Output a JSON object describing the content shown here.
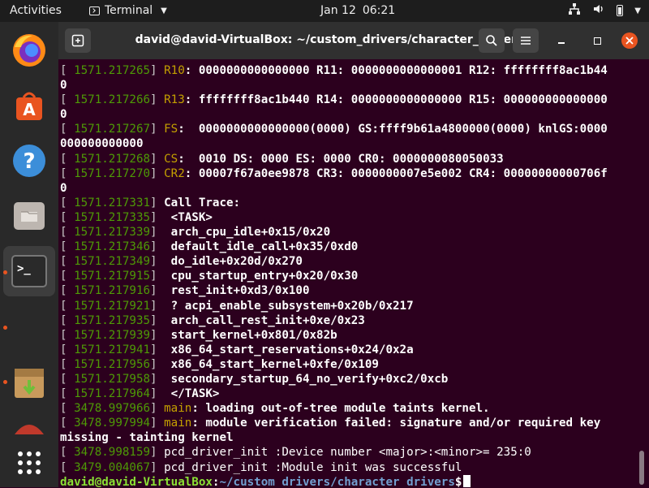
{
  "topbar": {
    "activities": "Activities",
    "app_name": "Terminal",
    "date": "Jan 12",
    "time": "06:21"
  },
  "dock": {
    "items": [
      "firefox-icon",
      "ubuntu-software-icon",
      "help-icon",
      "files-icon",
      "terminal-icon",
      "archive-installer-icon",
      "partial-app-icon",
      "show-apps-icon"
    ]
  },
  "window": {
    "title": "david@david-VirtualBox: ~/custom_drivers/character_drivers"
  },
  "colors": {
    "terminal_bg": "#2c001e",
    "timestamp": "#4e9a06",
    "register": "#c4a000",
    "prompt_user": "#8ae234",
    "prompt_path": "#729fcf",
    "close_button": "#e95420"
  },
  "terminal": {
    "lines": [
      {
        "ts": " 1571.217265",
        "label": "R10",
        "rest": ": 0000000000000000 R11: 0000000000000001 R12: ffffffff8ac1b44"
      },
      {
        "wrap": "0"
      },
      {
        "ts": " 1571.217266",
        "label": "R13",
        "rest": ": ffffffff8ac1b440 R14: 0000000000000000 R15: 000000000000000"
      },
      {
        "wrap": "0"
      },
      {
        "ts": " 1571.217267",
        "label": "FS",
        "rest": ":  0000000000000000(0000) GS:ffff9b61a4800000(0000) knlGS:0000"
      },
      {
        "wrap": "000000000000"
      },
      {
        "ts": " 1571.217268",
        "label": "CS",
        "rest": ":  0010 DS: 0000 ES: 0000 CR0: 0000000080050033"
      },
      {
        "ts": " 1571.217270",
        "label": "CR2",
        "rest": ": 00007f67a0ee9878 CR3: 0000000007e5e002 CR4: 00000000000706f"
      },
      {
        "wrap": "0"
      },
      {
        "ts": " 1571.217331",
        "text": "Call Trace:"
      },
      {
        "ts": " 1571.217335",
        "text": " <TASK>"
      },
      {
        "ts": " 1571.217339",
        "text": " arch_cpu_idle+0x15/0x20"
      },
      {
        "ts": " 1571.217346",
        "text": " default_idle_call+0x35/0xd0"
      },
      {
        "ts": " 1571.217349",
        "text": " do_idle+0x20d/0x270"
      },
      {
        "ts": " 1571.217915",
        "text": " cpu_startup_entry+0x20/0x30"
      },
      {
        "ts": " 1571.217916",
        "text": " rest_init+0xd3/0x100"
      },
      {
        "ts": " 1571.217921",
        "text": " ? acpi_enable_subsystem+0x20b/0x217"
      },
      {
        "ts": " 1571.217935",
        "text": " arch_call_rest_init+0xe/0x23"
      },
      {
        "ts": " 1571.217939",
        "text": " start_kernel+0x801/0x82b"
      },
      {
        "ts": " 1571.217941",
        "text": " x86_64_start_reservations+0x24/0x2a"
      },
      {
        "ts": " 1571.217956",
        "text": " x86_64_start_kernel+0xfe/0x109"
      },
      {
        "ts": " 1571.217958",
        "text": " secondary_startup_64_no_verify+0xc2/0xcb"
      },
      {
        "ts": " 1571.217964",
        "text": " </TASK>"
      },
      {
        "ts": " 3478.997966",
        "label": "main",
        "rest": ": loading out-of-tree module taints kernel."
      },
      {
        "ts": " 3478.997994",
        "label": "main",
        "rest": ": module verification failed: signature and/or required key"
      },
      {
        "wrap": "missing - tainting kernel"
      },
      {
        "ts": " 3478.998159",
        "plain": "pcd_driver_init :Device number <major>:<minor>= 235:0"
      },
      {
        "ts": " 3479.004067",
        "plain": "pcd_driver_init :Module init was successful"
      }
    ],
    "prompt": {
      "user": "david@david-VirtualBox",
      "sep": ":",
      "path": "~/custom_drivers/character_drivers",
      "symbol": "$ "
    }
  }
}
